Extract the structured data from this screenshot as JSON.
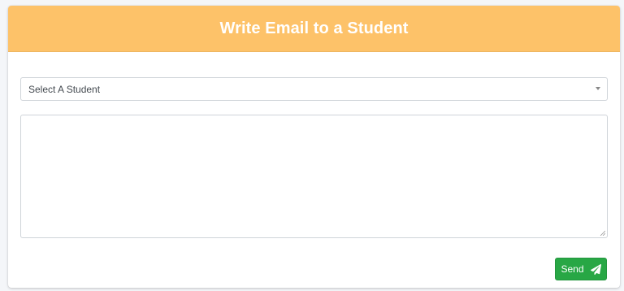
{
  "header": {
    "title": "Write Email to a Student",
    "accent_color": "#fdc269"
  },
  "form": {
    "student_select": {
      "selected": "Select A Student"
    },
    "message": {
      "value": ""
    },
    "send_button": {
      "label": "Send",
      "icon": "paper-plane-icon",
      "color": "#28a745"
    }
  }
}
